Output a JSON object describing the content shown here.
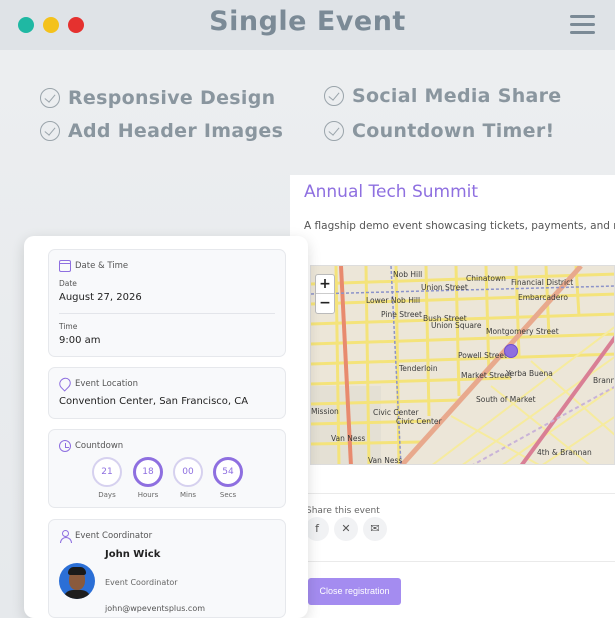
{
  "window": {
    "title": "Single Event"
  },
  "features": [
    "Responsive Design",
    "Add Header Images",
    "Social Media Share",
    "Countdown Timer!"
  ],
  "event": {
    "title": "Annual Tech Summit",
    "description": "A flagship demo event showcasing tickets, payments, and registration"
  },
  "map": {
    "zoom_in": "+",
    "zoom_out": "−",
    "labels": [
      "Nob Hill",
      "Chinatown",
      "Financial District",
      "Embarcadero",
      "Lower Nob Hill",
      "Union Square",
      "Tenderloin",
      "Montgomery Street",
      "Yerba Buena",
      "Powell Street",
      "Civic Center",
      "Civic Center",
      "South of Market",
      "Van Ness",
      "Mission",
      "4th & Brannan",
      "Union Street",
      "Market Street",
      "Bush Street",
      "Pine Street",
      "Van Ness",
      "Brannan"
    ]
  },
  "share": {
    "label": "Share this event",
    "icons": [
      "facebook-icon",
      "x-icon",
      "mail-icon"
    ]
  },
  "registration": {
    "close_label": "Close registration"
  },
  "details": {
    "date_time_title": "Date & Time",
    "date_label": "Date",
    "date_value": "August 27, 2026",
    "time_label": "Time",
    "time_value": "9:00 am",
    "location_title": "Event Location",
    "location_value": "Convention Center, San Francisco, CA",
    "countdown_title": "Countdown",
    "countdown": [
      {
        "value": "21",
        "unit": "Days"
      },
      {
        "value": "18",
        "unit": "Hours"
      },
      {
        "value": "00",
        "unit": "Mins"
      },
      {
        "value": "54",
        "unit": "Secs"
      }
    ],
    "coordinator_title": "Event Coordinator",
    "coordinator_name": "John Wick",
    "coordinator_role": "Event Coordinator",
    "coordinator_email": "john@wpeventsplus.com"
  },
  "colors": {
    "accent": "#8e6fe0",
    "button": "#a48cf0",
    "titlebar": "#dfe3e7"
  }
}
